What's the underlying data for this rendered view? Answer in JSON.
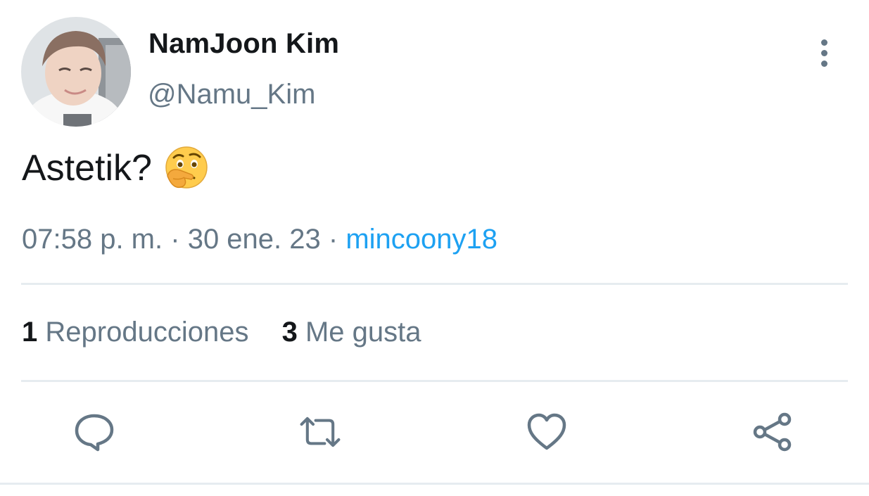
{
  "user": {
    "display_name": "NamJoon Kim",
    "handle": "@Namu_Kim",
    "avatar_icon": "profile-photo"
  },
  "tweet": {
    "text": "Astetik?",
    "emoji": "thinking-face-emoji"
  },
  "meta": {
    "time": "07:58 p. m.",
    "separator": "·",
    "date": "30 ene. 23",
    "source": "mincoony18"
  },
  "stats": {
    "views_count": "1",
    "views_label": "Reproducciones",
    "likes_count": "3",
    "likes_label": "Me gusta"
  },
  "actions": {
    "reply_icon": "reply-icon",
    "retweet_icon": "retweet-icon",
    "like_icon": "heart-icon",
    "share_icon": "share-icon"
  },
  "colors": {
    "text_primary": "#14171a",
    "text_secondary": "#657786",
    "link": "#1da1f2",
    "divider": "#e6ecf0"
  }
}
